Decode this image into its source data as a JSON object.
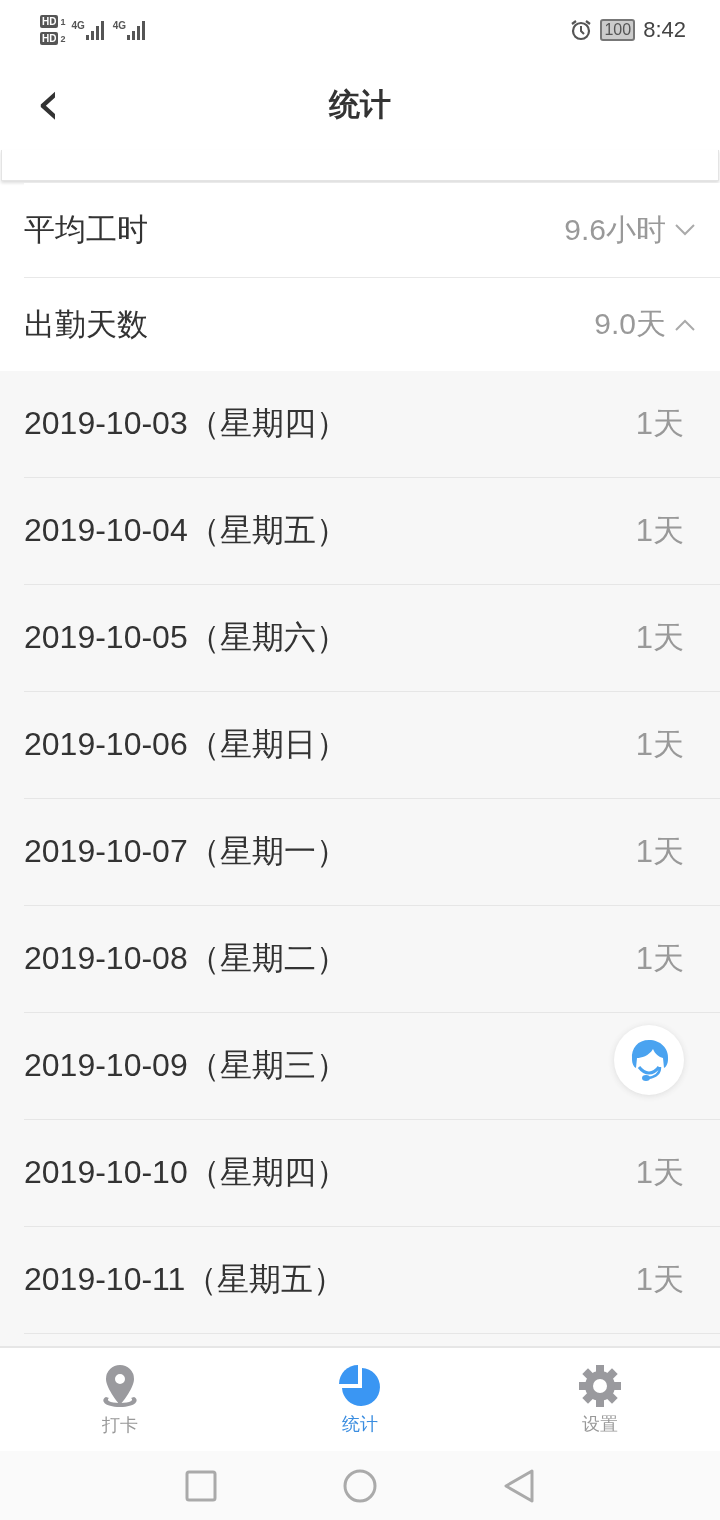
{
  "status_bar": {
    "sims": [
      {
        "hd": "HD",
        "slot": "1",
        "network": "4G"
      },
      {
        "hd": "HD",
        "slot": "2",
        "network": "4G"
      }
    ],
    "battery": "100",
    "time": "8:42"
  },
  "header": {
    "back": "‹",
    "title": "统计"
  },
  "stats": [
    {
      "label": "平均工时",
      "value": "9.6小时",
      "expanded": false
    },
    {
      "label": "出勤天数",
      "value": "9.0天",
      "expanded": true
    }
  ],
  "days": [
    {
      "date": "2019-10-03（星期四）",
      "value": "1天"
    },
    {
      "date": "2019-10-04（星期五）",
      "value": "1天"
    },
    {
      "date": "2019-10-05（星期六）",
      "value": "1天"
    },
    {
      "date": "2019-10-06（星期日）",
      "value": "1天"
    },
    {
      "date": "2019-10-07（星期一）",
      "value": "1天"
    },
    {
      "date": "2019-10-08（星期二）",
      "value": "1天"
    },
    {
      "date": "2019-10-09（星期三）"
    },
    {
      "date": "2019-10-10（星期四）",
      "value": "1天"
    },
    {
      "date": "2019-10-11（星期五）",
      "value": "1天"
    }
  ],
  "tabs": [
    {
      "kind": "pin",
      "label": "打卡",
      "selected": false
    },
    {
      "kind": "chart",
      "label": "统计",
      "selected": true
    },
    {
      "kind": "gear",
      "label": "设置",
      "selected": false
    }
  ]
}
